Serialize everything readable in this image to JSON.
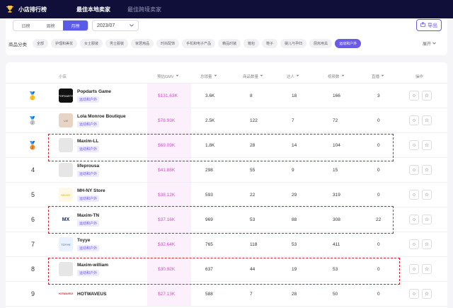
{
  "header": {
    "app_title": "小店排行榜",
    "tabs": [
      {
        "label": "最佳本地卖家",
        "active": true
      },
      {
        "label": "最佳跨境卖家",
        "active": false
      }
    ]
  },
  "filters": {
    "period_tabs": [
      {
        "label": "日榜",
        "active": false
      },
      {
        "label": "周榜",
        "active": false
      },
      {
        "label": "月榜",
        "active": true
      }
    ],
    "date_value": "2023/07",
    "export_label": "导出",
    "category_label": "商品分类",
    "categories": [
      {
        "label": "全部",
        "active": false
      },
      {
        "label": "护理和美妆",
        "active": false
      },
      {
        "label": "女士服装",
        "active": false
      },
      {
        "label": "男士服装",
        "active": false
      },
      {
        "label": "家居用品",
        "active": false
      },
      {
        "label": "时尚配饰",
        "active": false
      },
      {
        "label": "手机和电子产品",
        "active": false
      },
      {
        "label": "精品时装",
        "active": false
      },
      {
        "label": "箱包",
        "active": false
      },
      {
        "label": "鞋子",
        "active": false
      },
      {
        "label": "婴儿与孕妇",
        "active": false
      },
      {
        "label": "厨房用具",
        "active": false
      },
      {
        "label": "运动和户外",
        "active": true
      }
    ],
    "expand_label": "展开"
  },
  "table": {
    "columns": {
      "shop": "小店",
      "gmv": "预估GMV",
      "sales": "总销量",
      "products": "商品数量",
      "creators": "达人",
      "videos": "视频数",
      "live": "直播",
      "actions": "操作"
    },
    "rows": [
      {
        "rank": "1",
        "logo": "POPDARTS",
        "name": "Popdarts Game",
        "tag": "运动和户外",
        "gmv": "$131.63K",
        "sales": "3.6K",
        "products": "8",
        "creators": "18",
        "videos": "166",
        "live": "3"
      },
      {
        "rank": "2",
        "logo": "LM",
        "name": "Lola Monroe Boutique",
        "tag": "运动和户外",
        "gmv": "$78.93K",
        "sales": "2.5K",
        "products": "122",
        "creators": "7",
        "videos": "72",
        "live": "0"
      },
      {
        "rank": "3",
        "logo": "",
        "name": "Maxim-LL",
        "tag": "运动和户外",
        "gmv": "$69.09K",
        "sales": "1.8K",
        "products": "28",
        "creators": "14",
        "videos": "104",
        "live": "0"
      },
      {
        "rank": "4",
        "logo": "",
        "name": "lifeprousa",
        "tag": "运动和户外",
        "gmv": "$41.88K",
        "sales": "298",
        "products": "55",
        "creators": "9",
        "videos": "15",
        "live": "0"
      },
      {
        "rank": "5",
        "logo": "MH-NY",
        "name": "MH-NY Store",
        "tag": "运动和户外",
        "gmv": "$38.12K",
        "sales": "593",
        "products": "22",
        "creators": "29",
        "videos": "319",
        "live": "0"
      },
      {
        "rank": "6",
        "logo": "MX",
        "name": "Maxim-TN",
        "tag": "运动和户外",
        "gmv": "$37.16K",
        "sales": "969",
        "products": "53",
        "creators": "88",
        "videos": "308",
        "live": "22"
      },
      {
        "rank": "7",
        "logo": "TOYYE",
        "name": "Toyye",
        "tag": "运动和户外",
        "gmv": "$32.64K",
        "sales": "765",
        "products": "118",
        "creators": "53",
        "videos": "411",
        "live": "0"
      },
      {
        "rank": "8",
        "logo": "",
        "name": "Maxim-william",
        "tag": "运动和户外",
        "gmv": "$30.92K",
        "sales": "637",
        "products": "44",
        "creators": "19",
        "videos": "53",
        "live": "0"
      },
      {
        "rank": "9",
        "logo": "HOTWAVEUS",
        "name": "HOTWAVEUS",
        "tag": "",
        "gmv": "$27.13K",
        "sales": "588",
        "products": "7",
        "creators": "28",
        "videos": "50",
        "live": "0"
      }
    ]
  }
}
